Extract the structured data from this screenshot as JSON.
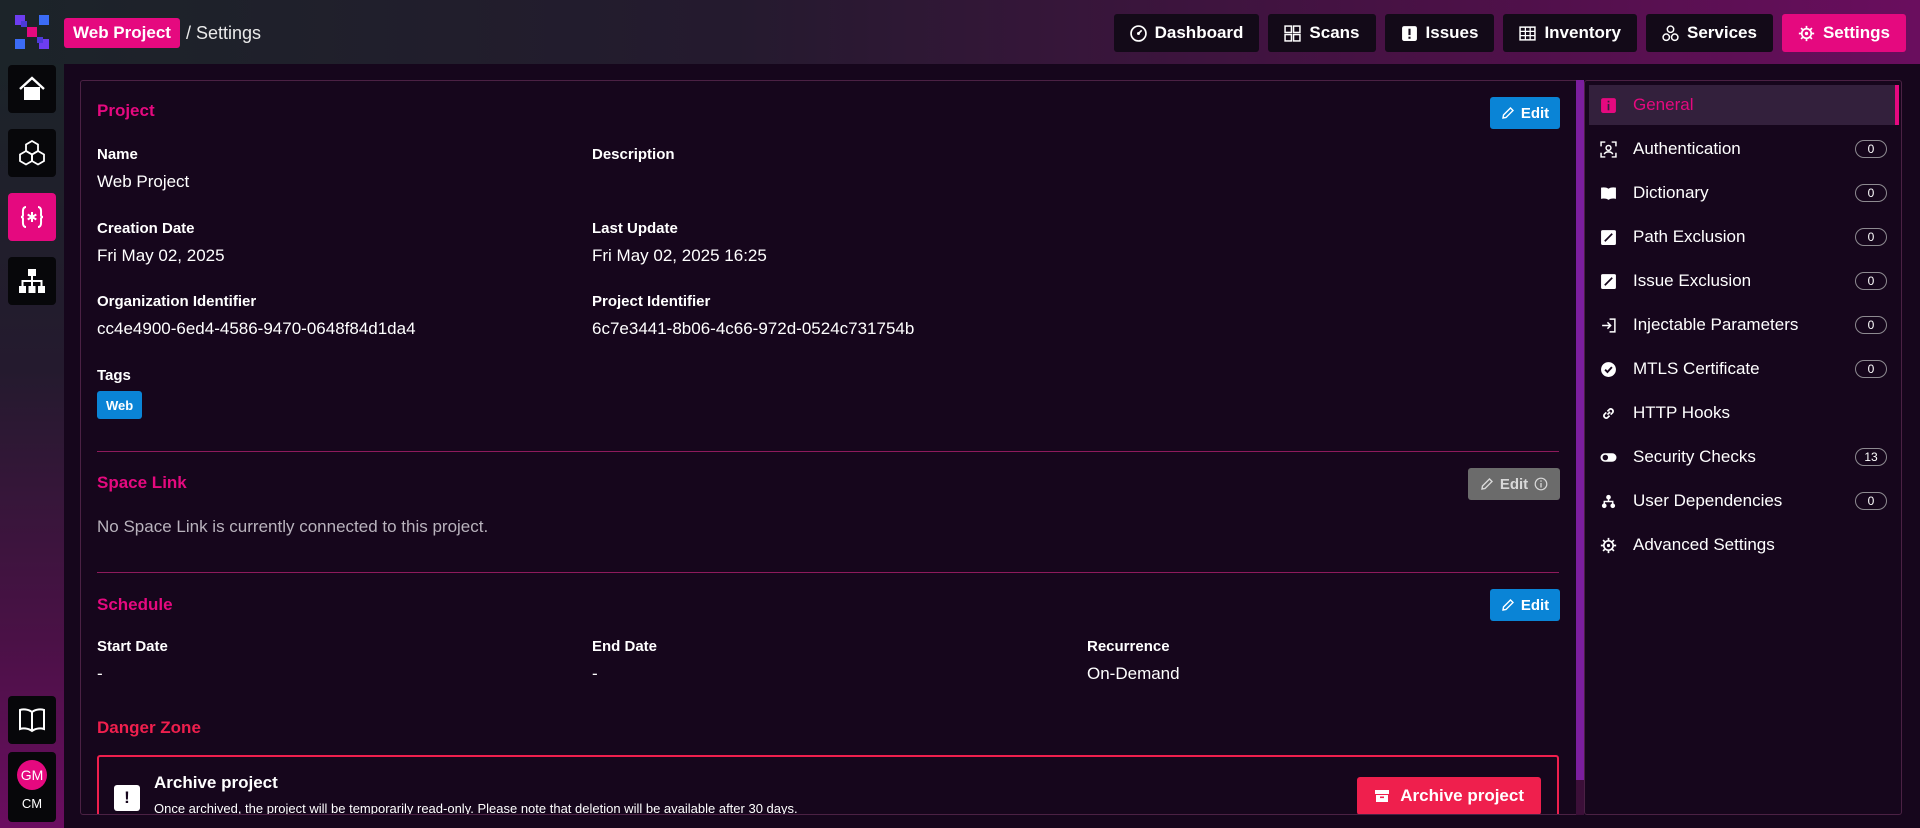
{
  "breadcrumb": {
    "project": "Web Project",
    "current": "/ Settings"
  },
  "nav": [
    {
      "label": "Dashboard",
      "icon": "gauge-icon"
    },
    {
      "label": "Scans",
      "icon": "grid-icon"
    },
    {
      "label": "Issues",
      "icon": "alert-icon"
    },
    {
      "label": "Inventory",
      "icon": "table-icon"
    },
    {
      "label": "Services",
      "icon": "services-icon"
    },
    {
      "label": "Settings",
      "icon": "gear-icon",
      "active": true
    }
  ],
  "rail": {
    "items": [
      "home-icon",
      "cubes-icon",
      "code-braces-icon",
      "sitemap-icon",
      "book-icon"
    ],
    "user": {
      "initials": "GM",
      "sub": "CM"
    }
  },
  "project": {
    "title": "Project",
    "edit": "Edit",
    "name_label": "Name",
    "name": "Web Project",
    "description_label": "Description",
    "description": "",
    "creation_label": "Creation Date",
    "creation": "Fri May 02, 2025",
    "update_label": "Last Update",
    "update": "Fri May 02, 2025 16:25",
    "org_label": "Organization Identifier",
    "org": "cc4e4900-6ed4-4586-9470-0648f84d1da4",
    "proj_label": "Project Identifier",
    "proj": "6c7e3441-8b06-4c66-972d-0524c731754b",
    "tags_label": "Tags",
    "tags": [
      "Web"
    ]
  },
  "space_link": {
    "title": "Space Link",
    "edit": "Edit",
    "message": "No Space Link is currently connected to this project."
  },
  "schedule": {
    "title": "Schedule",
    "edit": "Edit",
    "start_label": "Start Date",
    "start": "-",
    "end_label": "End Date",
    "end": "-",
    "recurrence_label": "Recurrence",
    "recurrence": "On-Demand"
  },
  "danger": {
    "title": "Danger Zone",
    "archive_title": "Archive project",
    "archive_desc": "Once archived, the project will be temporarily read-only. Please note that deletion will be available after 30 days.",
    "archive_button": "Archive project"
  },
  "settings_nav": [
    {
      "label": "General",
      "icon": "info-icon",
      "active": true
    },
    {
      "label": "Authentication",
      "icon": "user-scan-icon",
      "count": "0"
    },
    {
      "label": "Dictionary",
      "icon": "book-open-icon",
      "count": "0"
    },
    {
      "label": "Path Exclusion",
      "icon": "slash-square-icon",
      "count": "0"
    },
    {
      "label": "Issue Exclusion",
      "icon": "slash-square-icon",
      "count": "0"
    },
    {
      "label": "Injectable Parameters",
      "icon": "login-icon",
      "count": "0"
    },
    {
      "label": "MTLS Certificate",
      "icon": "badge-check-icon",
      "count": "0"
    },
    {
      "label": "HTTP Hooks",
      "icon": "link-icon"
    },
    {
      "label": "Security Checks",
      "icon": "toggle-icon",
      "count": "13"
    },
    {
      "label": "User Dependencies",
      "icon": "hierarchy-icon",
      "count": "0"
    },
    {
      "label": "Advanced Settings",
      "icon": "gear-icon"
    }
  ],
  "colors": {
    "accent": "#e5097f",
    "blue": "#0a84d6",
    "danger": "#ef1f4d",
    "background": "#16061c"
  }
}
